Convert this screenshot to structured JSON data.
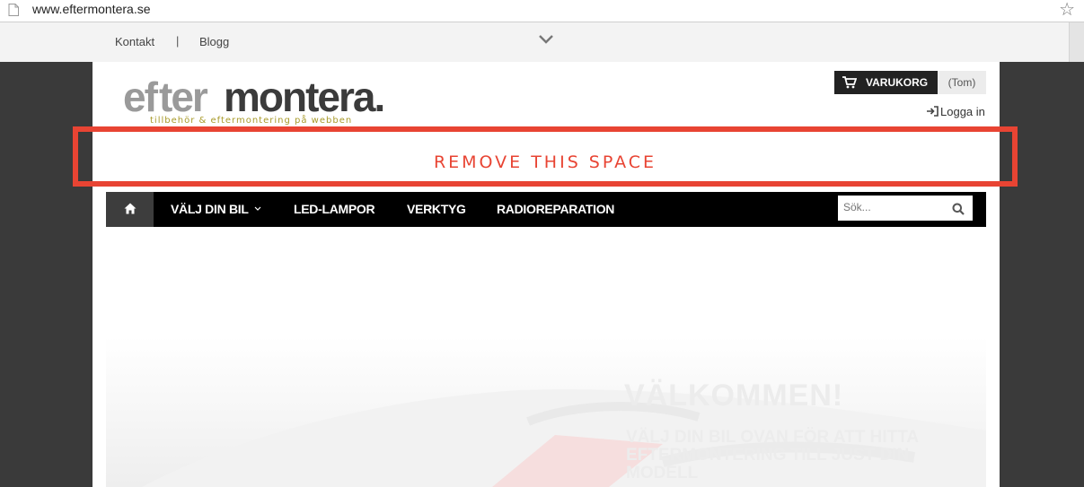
{
  "browser": {
    "url": "www.eftermontera.se"
  },
  "topbar": {
    "links": [
      "Kontakt",
      "Blogg"
    ],
    "separator": "|"
  },
  "header": {
    "logo_text": "eftermontera.se",
    "logo_tagline": "tillbehör & eftermontering på webben",
    "cart_label": "VARUKORG",
    "cart_user": "(Tom)",
    "login_label": "Logga in"
  },
  "annotation": {
    "text": "REMOVE THIS SPACE",
    "color": "#e84433"
  },
  "nav": {
    "items": [
      "VÄLJ DIN BIL",
      "LED-LAMPOR",
      "VERKTYG",
      "RADIOREPARATION"
    ],
    "search_placeholder": "Sök..."
  },
  "hero": {
    "title": "VÄLKOMMEN!",
    "subtitle": "VÄLJ DIN BIL OVAN FÖR ATT HITTA EFTERMONTERING TILL JUST DIN MODELL"
  },
  "colors": {
    "nav_bg": "#000000",
    "home_bg": "#3d3d3d",
    "page_bg": "#3a3a3a"
  }
}
